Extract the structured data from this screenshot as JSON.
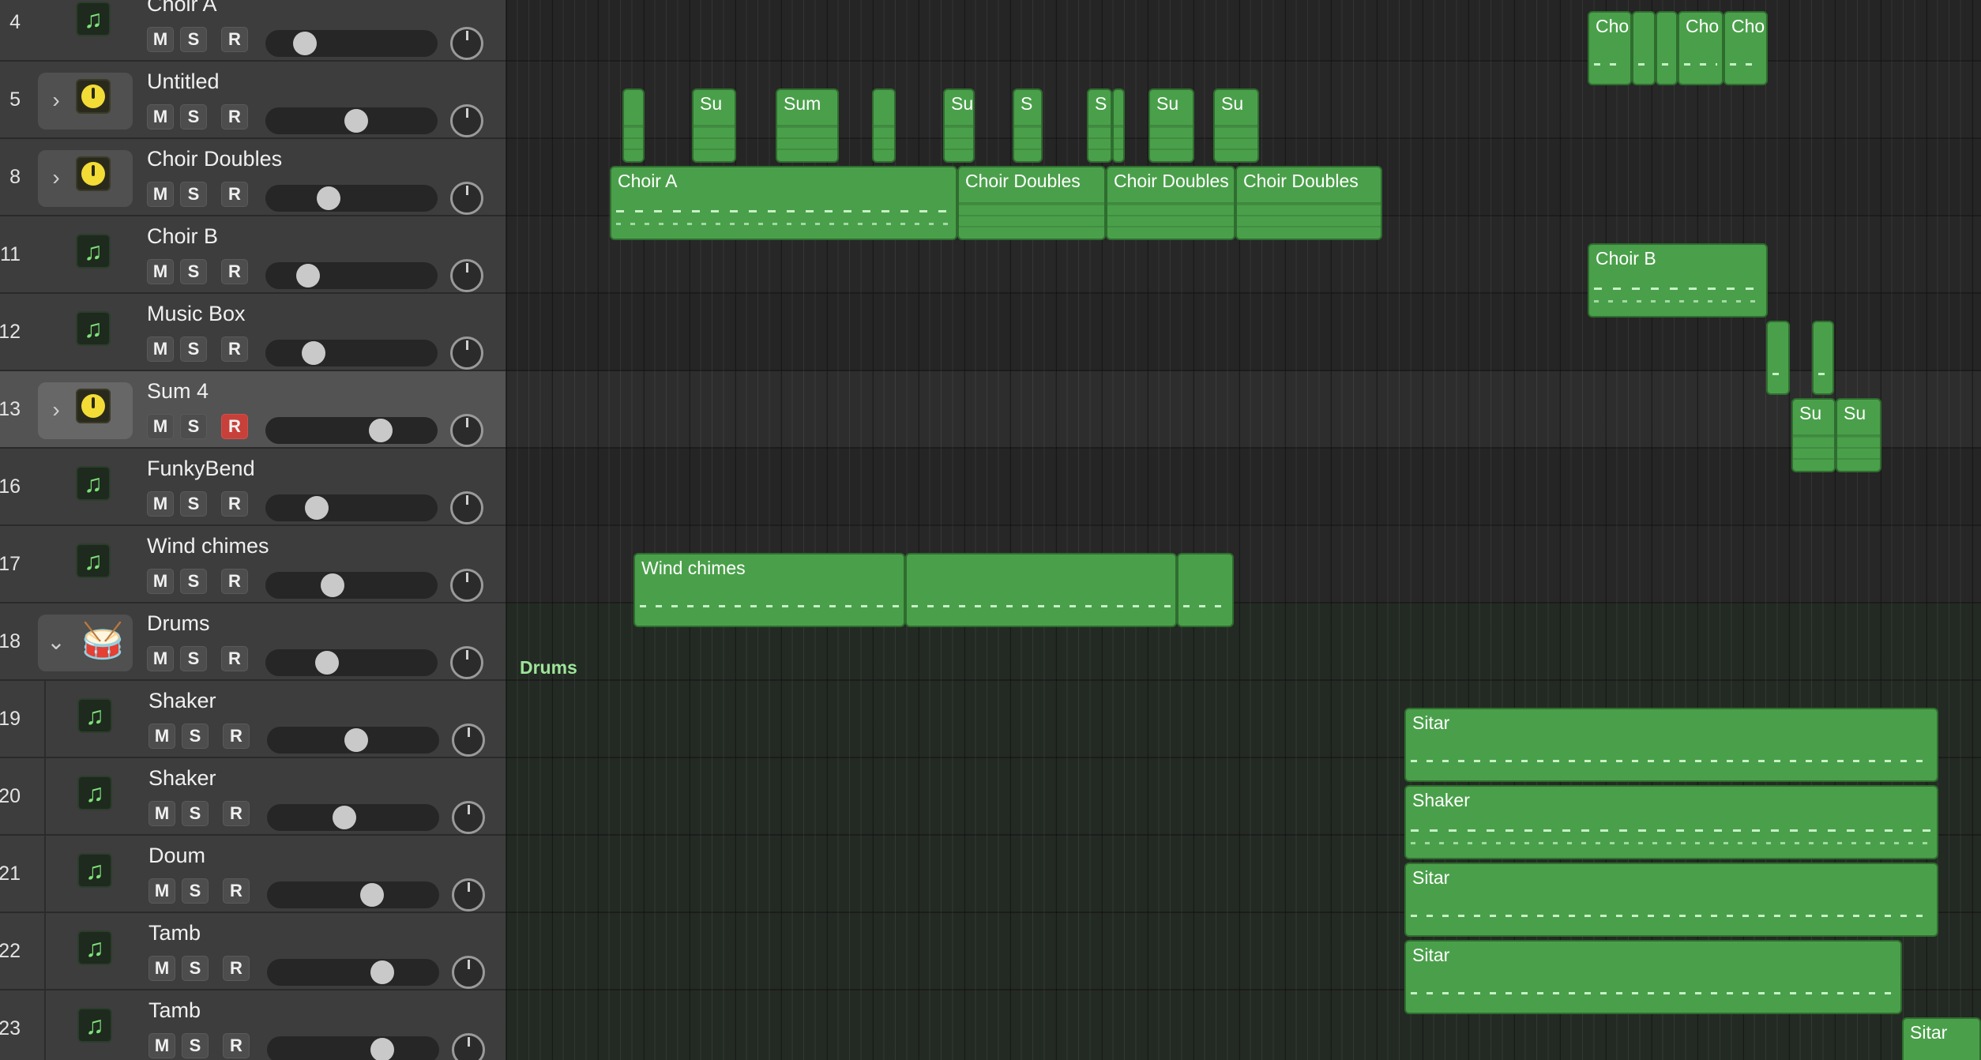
{
  "tracks": [
    {
      "number": "4",
      "name": "Choir A",
      "icon": "music-note-icon",
      "kind": "software",
      "record": false
    },
    {
      "number": "5",
      "name": "Untitled",
      "icon": "gauge-icon",
      "kind": "summing",
      "record": false
    },
    {
      "number": "8",
      "name": "Choir Doubles",
      "icon": "gauge-icon",
      "kind": "summing",
      "record": false
    },
    {
      "number": "11",
      "name": "Choir B",
      "icon": "music-note-icon",
      "kind": "software",
      "record": false
    },
    {
      "number": "12",
      "name": "Music Box",
      "icon": "music-note-icon",
      "kind": "software",
      "record": false
    },
    {
      "number": "13",
      "name": "Sum 4",
      "icon": "gauge-icon",
      "kind": "summing",
      "record": true
    },
    {
      "number": "16",
      "name": "FunkyBend",
      "icon": "music-note-icon",
      "kind": "software",
      "record": false
    },
    {
      "number": "17",
      "name": "Wind chimes",
      "icon": "music-note-icon",
      "kind": "software",
      "record": false
    },
    {
      "number": "18",
      "name": "Drums",
      "icon": "drum-kit-icon",
      "kind": "folder",
      "record": false
    },
    {
      "number": "19",
      "name": "Shaker",
      "icon": "music-note-icon",
      "kind": "child",
      "record": false
    },
    {
      "number": "20",
      "name": "Shaker",
      "icon": "music-note-icon",
      "kind": "child",
      "record": false
    },
    {
      "number": "21",
      "name": "Doum",
      "icon": "music-note-icon",
      "kind": "child",
      "record": false
    },
    {
      "number": "22",
      "name": "Tamb",
      "icon": "music-note-icon",
      "kind": "child",
      "record": false
    },
    {
      "number": "23",
      "name": "Tamb",
      "icon": "music-note-icon",
      "kind": "child",
      "record": false
    }
  ],
  "volume_levels": [
    0.18,
    0.53,
    0.34,
    0.2,
    0.24,
    0.7,
    0.26,
    0.37,
    0.33,
    0.52,
    0.44,
    0.63,
    0.7,
    0.7
  ],
  "buttons": {
    "mute": "M",
    "solo": "S",
    "record": "R"
  },
  "folder_lane_label": "Drums",
  "regions": {
    "choir_a_small": [
      "Cho",
      "Cho",
      "Cho"
    ],
    "untitled": [
      "Su",
      "Sum",
      "Su",
      "S",
      "S",
      "Su",
      "Su"
    ],
    "choir_doubles": [
      "Choir A",
      "Choir Doubles",
      "Choir Doubles",
      "Choir Doubles"
    ],
    "choir_b": "Choir B",
    "sum4": [
      "Su",
      "Su"
    ],
    "wind_chimes": "Wind chimes",
    "shaker1": "Sitar",
    "shaker2": "Shaker",
    "doum": "Sitar",
    "tamb1": "Sitar",
    "tamb2": "Sitar"
  },
  "colors": {
    "region_green": "#4aa04a",
    "record_on": "#c8403a",
    "gauge_yellow": "#f3dc36"
  }
}
